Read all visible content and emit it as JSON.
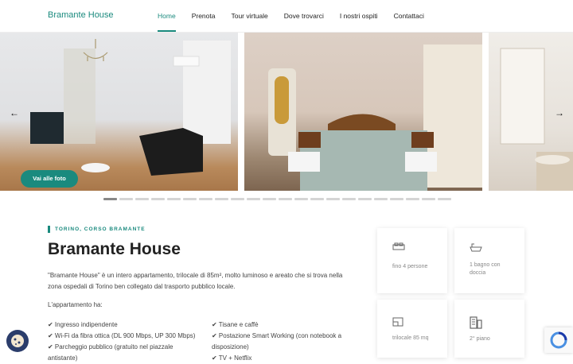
{
  "header": {
    "brand": "Bramante House",
    "nav": [
      {
        "label": "Home",
        "active": true
      },
      {
        "label": "Prenota"
      },
      {
        "label": "Tour virtuale"
      },
      {
        "label": "Dove trovarci"
      },
      {
        "label": "I nostri ospiti"
      },
      {
        "label": "Contattaci"
      }
    ]
  },
  "gallery": {
    "prev_arrow": "←",
    "next_arrow": "→",
    "photos_button": "Vai alle foto",
    "dot_count": 22
  },
  "content": {
    "eyebrow": "TORINO, CORSO BRAMANTE",
    "title": "Bramante House",
    "description": "\"Bramante House\" è un intero appartamento, trilocale di 85m², molto luminoso e areato che si trova nella zona ospedali di Torino ben collegato dal trasporto pubblico locale.",
    "has_label": "L'appartamento ha:",
    "features_left": [
      "✔ Ingresso indipendente",
      "✔ Wi-Fi da fibra ottica (DL 900 Mbps, UP 300 Mbps)",
      "✔ Parcheggio pubblico (gratuito nel piazzale antistante)"
    ],
    "features_right": [
      "✔ Tisane e caffè",
      "✔ Postazione Smart Working (con notebook a disposizione)",
      "✔ TV + Netflix"
    ]
  },
  "cards": [
    {
      "icon": "bed-icon",
      "text": "fino 4 persone"
    },
    {
      "icon": "bathtub-icon",
      "text": "1 bagno con doccia"
    },
    {
      "icon": "floor-area-icon",
      "text": "trilocale 85 mq"
    },
    {
      "icon": "building-icon",
      "text": "2° piano"
    }
  ],
  "colors": {
    "accent": "#1a8a7e",
    "cookie": "#2b3d6b"
  }
}
